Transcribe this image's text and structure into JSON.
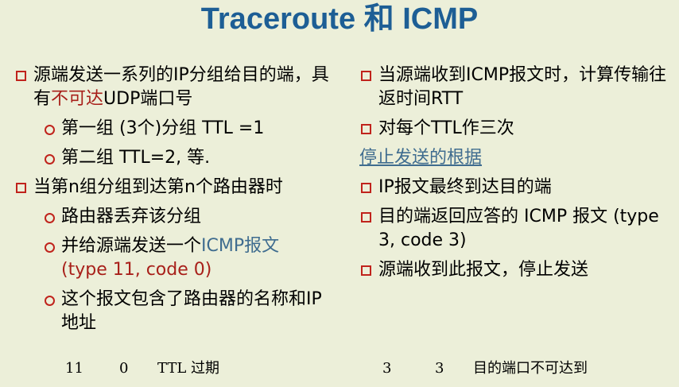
{
  "title": "Traceroute 和 ICMP",
  "left": {
    "b1": {
      "a": "源端发送一系列的IP分组给目的端，具有",
      "hl": "不可达",
      "b": "UDP端口号"
    },
    "b1_s1": "第一组 (3个)分组  TTL =1",
    "b1_s2": "第二组   TTL=2, 等.",
    "b2": "当第n组分组到达第n个路由器时",
    "b2_s1": "路由器丢弃该分组",
    "b2_s2": {
      "a": "并给源端发送一个",
      "hl": "ICMP报文",
      "line2": "(type 11, code 0)"
    },
    "b2_s3": "这个报文包含了路由器的名称和IP地址"
  },
  "right": {
    "b1": "当源端收到ICMP报文时，计算传输往返时间RTT",
    "b2": "对每个TTL作三次",
    "stop_heading": "停止发送的根据",
    "b3": "IP报文最终到达目的端",
    "b4": "目的端返回应答的 ICMP 报文 (type 3, code 3)",
    "b5": "源端收到此报文，停止发送"
  },
  "footer": {
    "left_type": "11",
    "left_code": "0",
    "left_desc": "TTL 过期",
    "right_type": "3",
    "right_code": "3",
    "right_desc": "目的端口不可达到"
  },
  "colors": {
    "title": "#1d5e95",
    "highlight": "#a8201a",
    "link": "#3f6c8f",
    "bullet": "#c0231c",
    "background": "#ecefd9"
  }
}
